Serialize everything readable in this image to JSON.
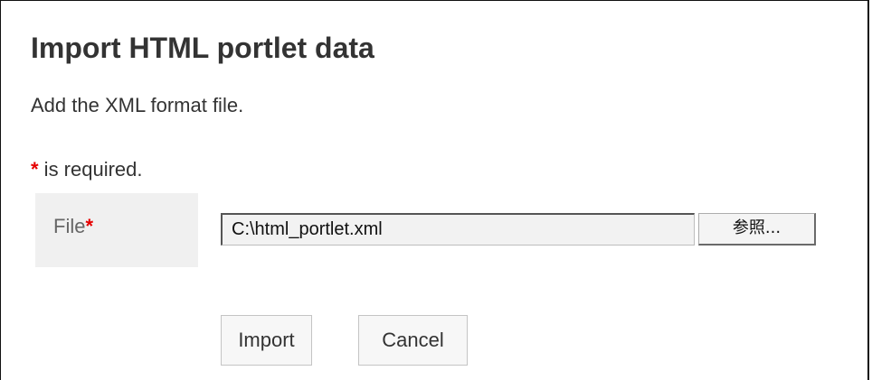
{
  "dialog": {
    "title": "Import HTML portlet data",
    "description": "Add the XML format file.",
    "required_marker": "*",
    "required_note": " is required."
  },
  "form": {
    "file_label": "File",
    "file_required_marker": "*",
    "file_value": "C:\\html_portlet.xml",
    "browse_label": "参照..."
  },
  "actions": {
    "import_label": "Import",
    "cancel_label": "Cancel"
  },
  "colors": {
    "required": "#e60000",
    "text": "#333333",
    "label_bg": "#f0f0f0"
  }
}
